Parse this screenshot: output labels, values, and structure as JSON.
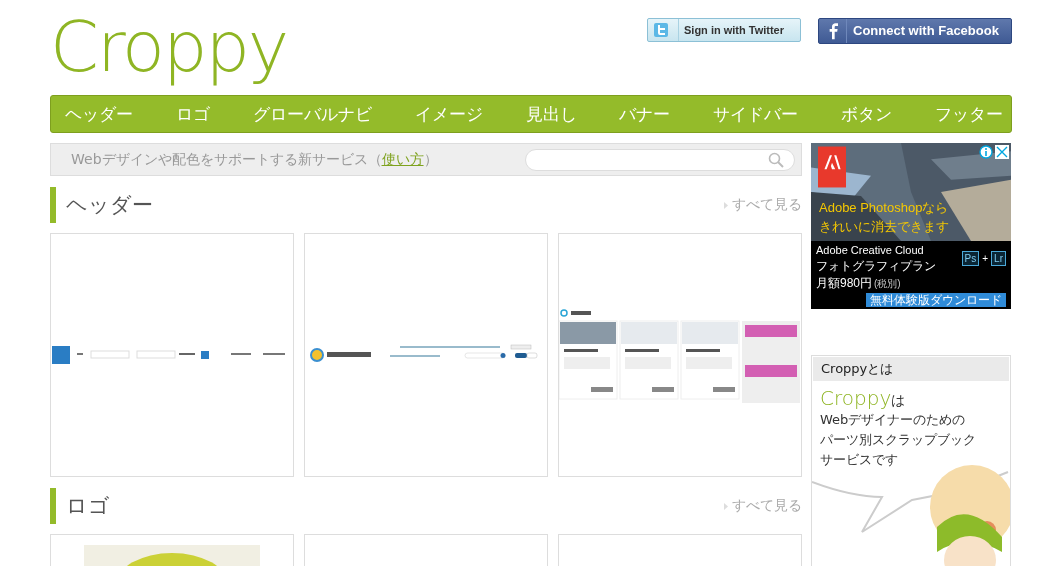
{
  "logo": "Croppy",
  "social": [
    {
      "kind": "twitter",
      "label": "Sign in with Twitter"
    },
    {
      "kind": "facebook",
      "label": "Connect with Facebook"
    }
  ],
  "nav": [
    "ヘッダー",
    "ロゴ",
    "グローバルナビ",
    "イメージ",
    "見出し",
    "バナー",
    "サイドバー",
    "ボタン",
    "フッター"
  ],
  "intro": {
    "text": "Webデザインや配色をサポートする新サービス（",
    "link": "使い方",
    "close": "）"
  },
  "sections": [
    {
      "title": "ヘッダー",
      "more": "すべて見る",
      "thumbs": [
        {
          "kind": "bar"
        },
        {
          "kind": "college"
        },
        {
          "kind": "services"
        }
      ]
    },
    {
      "title": "ロゴ",
      "more": "すべて見る",
      "thumbs": [
        {
          "kind": "circle"
        },
        {
          "kind": "empty"
        },
        {
          "kind": "empty"
        }
      ]
    }
  ],
  "ad": {
    "headline": [
      "Adobe Photoshopなら",
      "きれいに消去できます"
    ],
    "product": "Adobe Creative Cloud",
    "plan": "フォトグラフィプラン",
    "price": "月額980円",
    "tax": "(税別)",
    "badges": [
      "Ps",
      "Lr"
    ],
    "plus": "+",
    "cta": "無料体験版ダウンロード"
  },
  "about": {
    "title": "Croppyとは",
    "brand": "Croppy",
    "particle": "は",
    "lines": [
      "Webデザイナーのための",
      "パーツ別スクラップブック",
      "サービスです"
    ]
  }
}
